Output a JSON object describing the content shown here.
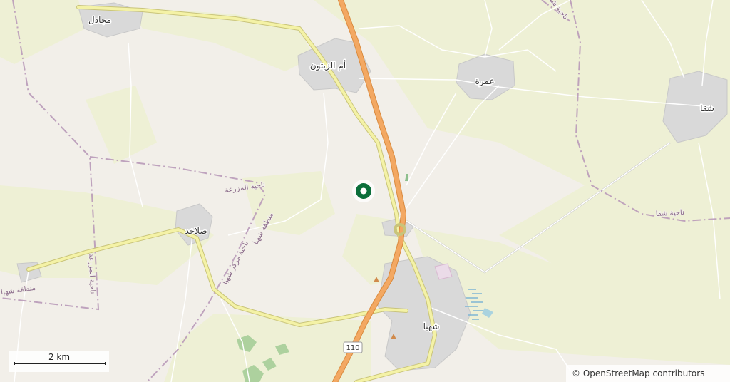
{
  "map": {
    "places": [
      {
        "id": "majadel",
        "name": "مجادل"
      },
      {
        "id": "umm-zaitoun",
        "name": "أم الزيتون"
      },
      {
        "id": "umra",
        "name": "عمرة"
      },
      {
        "id": "shaqqa",
        "name": "شقا"
      },
      {
        "id": "salakhad",
        "name": "صلاخد"
      },
      {
        "id": "shahba",
        "name": "شهبا"
      }
    ],
    "admin_labels": [
      {
        "id": "nahiya-mazraa",
        "text": "ناحية المزرعة"
      },
      {
        "id": "mintaqa-shahba",
        "text": "منطقة شهبا"
      },
      {
        "id": "nahiya-markaz-shahba",
        "text": "ناحية مركز شهبا"
      },
      {
        "id": "nahiya-shaqqa",
        "text": "ناحية شقا"
      },
      {
        "id": "nahiya-mazraa-2",
        "text": "ناحية المزرعة"
      },
      {
        "id": "mintaqa-shahba-2",
        "text": "منطقة شهبا"
      },
      {
        "id": "nahiya-shaqqa-top",
        "text": "ناحية شقا"
      }
    ],
    "road_shield": "110",
    "marker": {
      "color": "#0b6e3a"
    }
  },
  "scale": {
    "label": "2 km"
  },
  "attribution": {
    "text": "© OpenStreetMap contributors"
  },
  "colors": {
    "background": "#f2efe9",
    "farmland": "#eef0d5",
    "trunk_road": "#f3a862",
    "primary_road": "#f4f2a6",
    "urban": "#d9d9d9",
    "admin_border": "#b99ab9",
    "water": "#aad3df"
  }
}
